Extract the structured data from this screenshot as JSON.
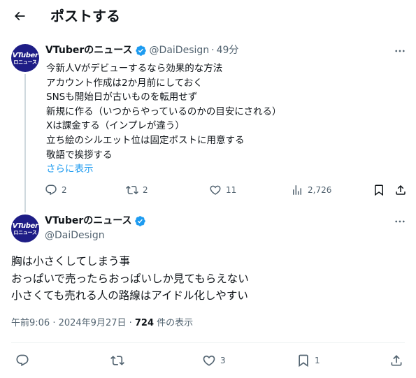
{
  "header": {
    "title": "ポストする"
  },
  "reply_post": {
    "avatar_text_line1": "VTuber",
    "avatar_text_line2": "ロニュース",
    "display_name": "VTuberのニュース",
    "handle": "@DaiDesign",
    "separator": "·",
    "time": "49分",
    "lines": [
      "今新人Vがデビューするなら効果的な方法",
      "アカウント作成は2か月前にしておく",
      "SNSも開始日が古いものを転用せず",
      "新規に作る（いつからやっているのかの目安にされる）",
      "Xは課金する（インプレが違う）",
      "立ち絵のシルエット位は固定ポストに用意する",
      "敬語で挨拶する"
    ],
    "show_more": "さらに表示",
    "actions": {
      "replies": "2",
      "reposts": "2",
      "likes": "11",
      "views": "2,726"
    }
  },
  "main_post": {
    "avatar_text_line1": "VTuber",
    "avatar_text_line2": "ロニュース",
    "display_name": "VTuberのニュース",
    "handle": "@DaiDesign",
    "lines": [
      "胸は小さくしてしまう事",
      "おっぱいで売ったらおっぱいしか見てもらえない",
      "小さくても売れる人の路線はアイドル化しやすい"
    ],
    "timestamp": "午前9:06 · 2024年9月27日 · ",
    "views_count": "724",
    "views_label": " 件の表示",
    "actions": {
      "replies": "",
      "reposts": "",
      "likes": "3",
      "bookmarks": "1"
    }
  },
  "colors": {
    "accent": "#1d9bf0",
    "verified": "#1d9bf0",
    "secondary_text": "#536471",
    "avatar_bg": "#1e1d86"
  },
  "icons": [
    "back-arrow-icon",
    "verified-badge-icon",
    "more-icon",
    "reply-icon",
    "repost-icon",
    "like-icon",
    "views-icon",
    "bookmark-icon",
    "share-icon"
  ]
}
